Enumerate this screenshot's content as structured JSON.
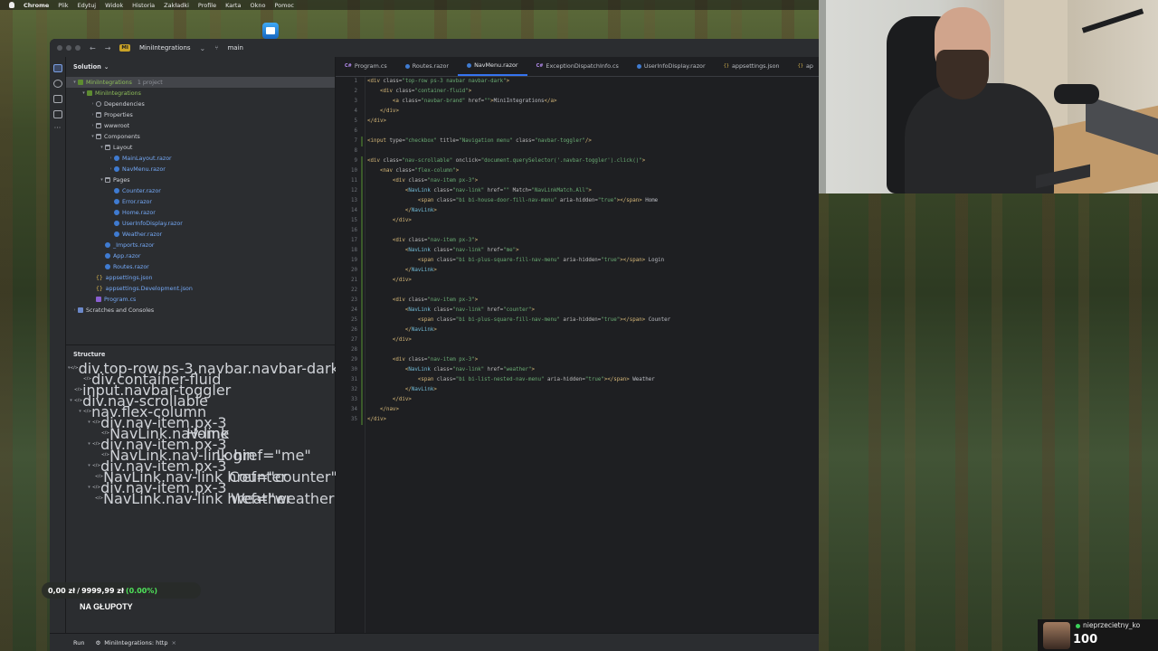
{
  "menubar": {
    "app": "Chrome",
    "items": [
      "Plik",
      "Edytuj",
      "Widok",
      "Historia",
      "Zakładki",
      "Profile",
      "Karta",
      "Okno",
      "Pomoc"
    ]
  },
  "titlebar": {
    "project_badge": "MI",
    "project": "MiniIntegrations",
    "branch": "main"
  },
  "solution": {
    "header": "Solution",
    "tree": [
      {
        "label": "MiniIntegrations",
        "hint": "1 project",
        "indent": 0,
        "icon": "proj",
        "chev": "▾",
        "cls": "green",
        "sel": true
      },
      {
        "label": "MiniIntegrations",
        "hint": "",
        "indent": 1,
        "icon": "proj",
        "chev": "▾",
        "cls": "green"
      },
      {
        "label": "Dependencies",
        "hint": "",
        "indent": 2,
        "icon": "dep",
        "chev": "›",
        "cls": ""
      },
      {
        "label": "Properties",
        "hint": "",
        "indent": 2,
        "icon": "folder",
        "chev": "›",
        "cls": ""
      },
      {
        "label": "wwwroot",
        "hint": "",
        "indent": 2,
        "icon": "folder",
        "chev": "›",
        "cls": ""
      },
      {
        "label": "Components",
        "hint": "",
        "indent": 2,
        "icon": "folder",
        "chev": "▾",
        "cls": ""
      },
      {
        "label": "Layout",
        "hint": "",
        "indent": 3,
        "icon": "folder",
        "chev": "▾",
        "cls": ""
      },
      {
        "label": "MainLayout.razor",
        "hint": "",
        "indent": 4,
        "icon": "razor",
        "chev": "›",
        "cls": "razor-txt"
      },
      {
        "label": "NavMenu.razor",
        "hint": "",
        "indent": 4,
        "icon": "razor",
        "chev": "›",
        "cls": "razor-txt"
      },
      {
        "label": "Pages",
        "hint": "",
        "indent": 3,
        "icon": "folder",
        "chev": "▾",
        "cls": ""
      },
      {
        "label": "Counter.razor",
        "hint": "",
        "indent": 4,
        "icon": "razor",
        "chev": "",
        "cls": "razor-txt"
      },
      {
        "label": "Error.razor",
        "hint": "",
        "indent": 4,
        "icon": "razor",
        "chev": "",
        "cls": "razor-txt"
      },
      {
        "label": "Home.razor",
        "hint": "",
        "indent": 4,
        "icon": "razor",
        "chev": "",
        "cls": "razor-txt"
      },
      {
        "label": "UserInfoDisplay.razor",
        "hint": "",
        "indent": 4,
        "icon": "razor",
        "chev": "",
        "cls": "razor-txt"
      },
      {
        "label": "Weather.razor",
        "hint": "",
        "indent": 4,
        "icon": "razor",
        "chev": "",
        "cls": "razor-txt"
      },
      {
        "label": "_Imports.razor",
        "hint": "",
        "indent": 3,
        "icon": "razor",
        "chev": "",
        "cls": "razor-txt"
      },
      {
        "label": "App.razor",
        "hint": "",
        "indent": 3,
        "icon": "razor",
        "chev": "",
        "cls": "razor-txt"
      },
      {
        "label": "Routes.razor",
        "hint": "",
        "indent": 3,
        "icon": "razor",
        "chev": "",
        "cls": "razor-txt"
      },
      {
        "label": "appsettings.json",
        "hint": "",
        "indent": 2,
        "icon": "json",
        "chev": "",
        "cls": "razor-txt"
      },
      {
        "label": "appsettings.Development.json",
        "hint": "",
        "indent": 2,
        "icon": "json",
        "chev": "",
        "cls": "razor-txt"
      },
      {
        "label": "Program.cs",
        "hint": "",
        "indent": 2,
        "icon": "cs",
        "chev": "",
        "cls": "razor-txt"
      },
      {
        "label": "Scratches and Consoles",
        "hint": "",
        "indent": 0,
        "icon": "scratch",
        "chev": "›",
        "cls": ""
      }
    ]
  },
  "structure": {
    "header": "Structure",
    "rows": [
      {
        "label": "div.top-row.ps-3.navbar.navbar-dark",
        "value": "",
        "indent": 0,
        "chev": "▾"
      },
      {
        "label": "div.container-fluid",
        "value": "",
        "indent": 1,
        "chev": ""
      },
      {
        "label": "input.navbar-toggler",
        "value": "",
        "indent": 0,
        "chev": ""
      },
      {
        "label": "div.nav-scrollable",
        "value": "",
        "indent": 0,
        "chev": "▾"
      },
      {
        "label": "nav.flex-column",
        "value": "",
        "indent": 1,
        "chev": "▾"
      },
      {
        "label": "div.nav-item.px-3",
        "value": "",
        "indent": 2,
        "chev": "▾"
      },
      {
        "label": "NavLink.nav-link",
        "value": "Home",
        "indent": 3,
        "chev": ""
      },
      {
        "label": "div.nav-item.px-3",
        "value": "",
        "indent": 2,
        "chev": "▾"
      },
      {
        "label": "NavLink.nav-link href=\"me\"",
        "value": "Login",
        "indent": 3,
        "chev": ""
      },
      {
        "label": "div.nav-item.px-3",
        "value": "",
        "indent": 2,
        "chev": "▾"
      },
      {
        "label": "NavLink.nav-link href=\"counter\"",
        "value": "Counter",
        "indent": 3,
        "chev": ""
      },
      {
        "label": "div.nav-item.px-3",
        "value": "",
        "indent": 2,
        "chev": "▾"
      },
      {
        "label": "NavLink.nav-link href=\"weather\"",
        "value": "Weather",
        "indent": 3,
        "chev": ""
      }
    ]
  },
  "tabs": [
    {
      "label": "Program.cs",
      "icon": "cs",
      "active": false
    },
    {
      "label": "Routes.razor",
      "icon": "razor",
      "active": false
    },
    {
      "label": "NavMenu.razor",
      "icon": "razor",
      "active": true
    },
    {
      "label": "ExceptionDispatchInfo.cs",
      "icon": "cs",
      "active": false
    },
    {
      "label": "UserInfoDisplay.razor",
      "icon": "razor",
      "active": false
    },
    {
      "label": "appsettings.json",
      "icon": "json",
      "active": false
    },
    {
      "label": "ap",
      "icon": "json",
      "active": false
    }
  ],
  "code_lines": [
    "<div class=\"top-row ps-3 navbar navbar-dark\">",
    "    <div class=\"container-fluid\">",
    "        <a class=\"navbar-brand\" href=\"\">MiniIntegrations</a>",
    "    </div>",
    "</div>",
    "",
    "<input type=\"checkbox\" title=\"Navigation menu\" class=\"navbar-toggler\"/>",
    "",
    "<div class=\"nav-scrollable\" onclick=\"document.querySelector('.navbar-toggler').click()\">",
    "    <nav class=\"flex-column\">",
    "        <div class=\"nav-item px-3\">",
    "            <NavLink class=\"nav-link\" href=\"\" Match=\"NavLinkMatch.All\">",
    "                <span class=\"bi bi-house-door-fill-nav-menu\" aria-hidden=\"true\"></span> Home",
    "            </NavLink>",
    "        </div>",
    "",
    "        <div class=\"nav-item px-3\">",
    "            <NavLink class=\"nav-link\" href=\"me\">",
    "                <span class=\"bi bi-plus-square-fill-nav-menu\" aria-hidden=\"true\"></span> Login",
    "            </NavLink>",
    "        </div>",
    "",
    "        <div class=\"nav-item px-3\">",
    "            <NavLink class=\"nav-link\" href=\"counter\">",
    "                <span class=\"bi bi-plus-square-fill-nav-menu\" aria-hidden=\"true\"></span> Counter",
    "            </NavLink>",
    "        </div>",
    "",
    "        <div class=\"nav-item px-3\">",
    "            <NavLink class=\"nav-link\" href=\"weather\">",
    "                <span class=\"bi bi-list-nested-nav-menu\" aria-hidden=\"true\"></span> Weather",
    "            </NavLink>",
    "        </div>",
    "    </nav>",
    "</div>"
  ],
  "bottombar": {
    "run": "Run",
    "run_config": "MiniIntegrations: http"
  },
  "overlay": {
    "price_current": "0,00 zł",
    "price_sep": "/",
    "price_target": "9999,99 zł",
    "price_pct": "(0.00%)",
    "label": "NA GŁUPOTY"
  },
  "viewer": {
    "name": "nieprzecietny_ko",
    "count": "100"
  },
  "colors": {
    "editor_bg": "#1e1f22",
    "panel_bg": "#2b2d30",
    "accent": "#3574f0",
    "tag": "#d5b778",
    "string": "#6aab73",
    "component": "#73bdd8"
  }
}
